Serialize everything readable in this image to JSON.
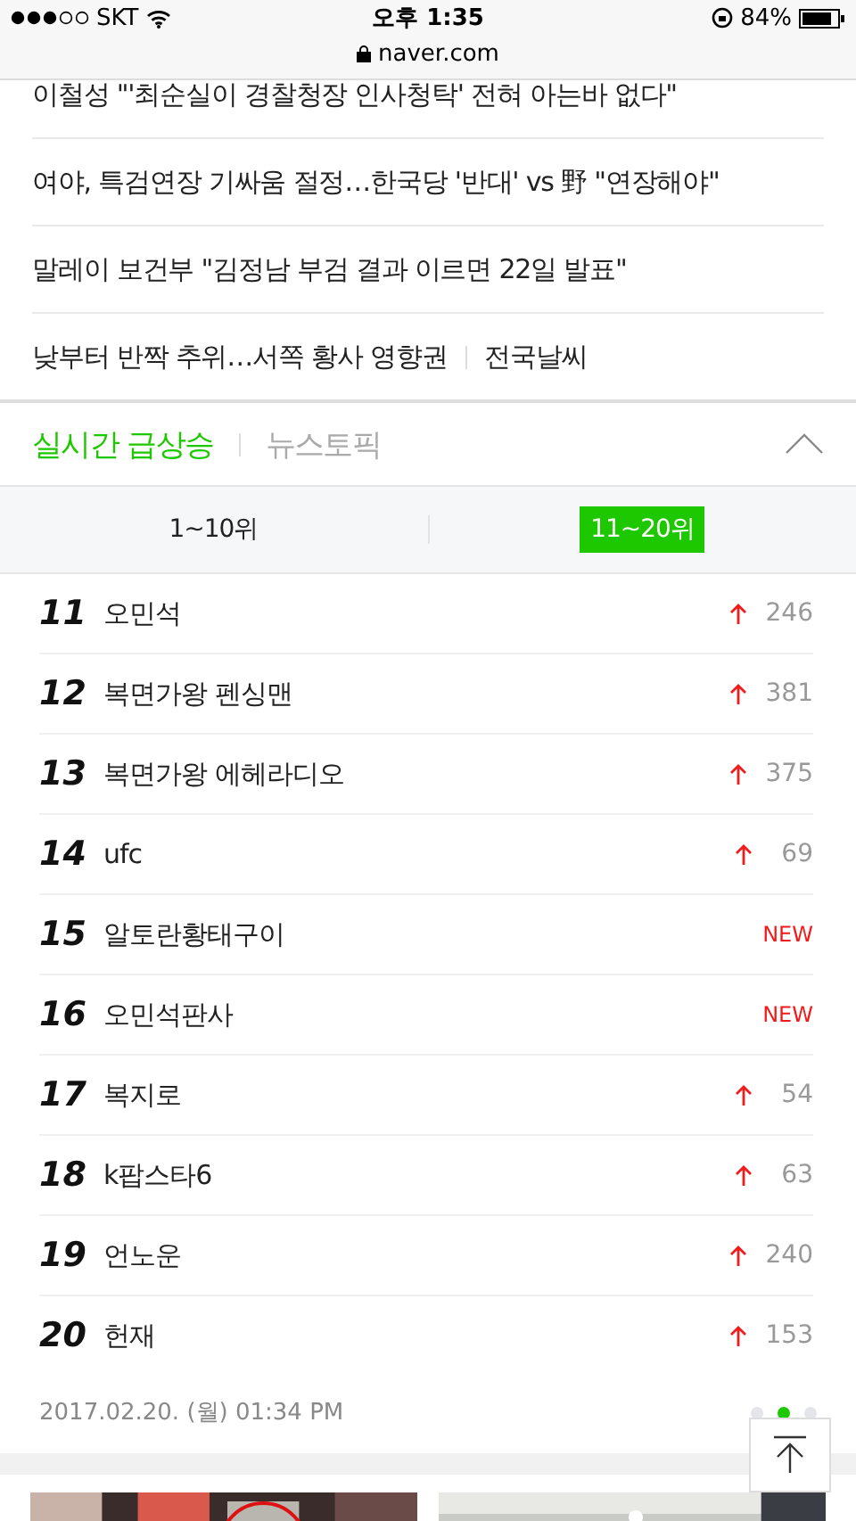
{
  "status_bar": {
    "carrier": "SKT",
    "time": "오후 1:35",
    "battery": "84%",
    "url": "naver.com"
  },
  "news": [
    {
      "title": "이철성 \"'최순실이 경찰청장 인사청탁' 전혀 아는바 없다\""
    },
    {
      "title": "여야, 특검연장 기싸움 절정…한국당 '반대' vs 野 \"연장해야\""
    },
    {
      "title": "말레이 보건부 \"김정남 부검 결과 이르면 22일 발표\""
    },
    {
      "title": "낮부터 반짝 추위…서쪽 황사 영향권",
      "link": "전국날씨"
    }
  ],
  "section_tabs": [
    {
      "label": "실시간 급상승",
      "selected": true
    },
    {
      "label": "뉴스토픽",
      "selected": false
    }
  ],
  "range_tabs": [
    {
      "label": "1~10위",
      "selected": false
    },
    {
      "label": "11~20위",
      "selected": true
    }
  ],
  "rankings": [
    {
      "rank": "11",
      "keyword": "오민석",
      "kind": "up",
      "change": "246"
    },
    {
      "rank": "12",
      "keyword": "복면가왕 펜싱맨",
      "kind": "up",
      "change": "381"
    },
    {
      "rank": "13",
      "keyword": "복면가왕 에헤라디오",
      "kind": "up",
      "change": "375"
    },
    {
      "rank": "14",
      "keyword": "ufc",
      "kind": "up",
      "change": "69"
    },
    {
      "rank": "15",
      "keyword": "알토란황태구이",
      "kind": "new",
      "change": "NEW"
    },
    {
      "rank": "16",
      "keyword": "오민석판사",
      "kind": "new",
      "change": "NEW"
    },
    {
      "rank": "17",
      "keyword": "복지로",
      "kind": "up",
      "change": "54"
    },
    {
      "rank": "18",
      "keyword": "k팝스타6",
      "kind": "up",
      "change": "63"
    },
    {
      "rank": "19",
      "keyword": "언노운",
      "kind": "up",
      "change": "240"
    },
    {
      "rank": "20",
      "keyword": "헌재",
      "kind": "up",
      "change": "153"
    }
  ],
  "timestamp": "2017.02.20. (월) 01:34 PM",
  "pages": [
    {
      "selected": false
    },
    {
      "selected": true
    },
    {
      "selected": false
    }
  ]
}
